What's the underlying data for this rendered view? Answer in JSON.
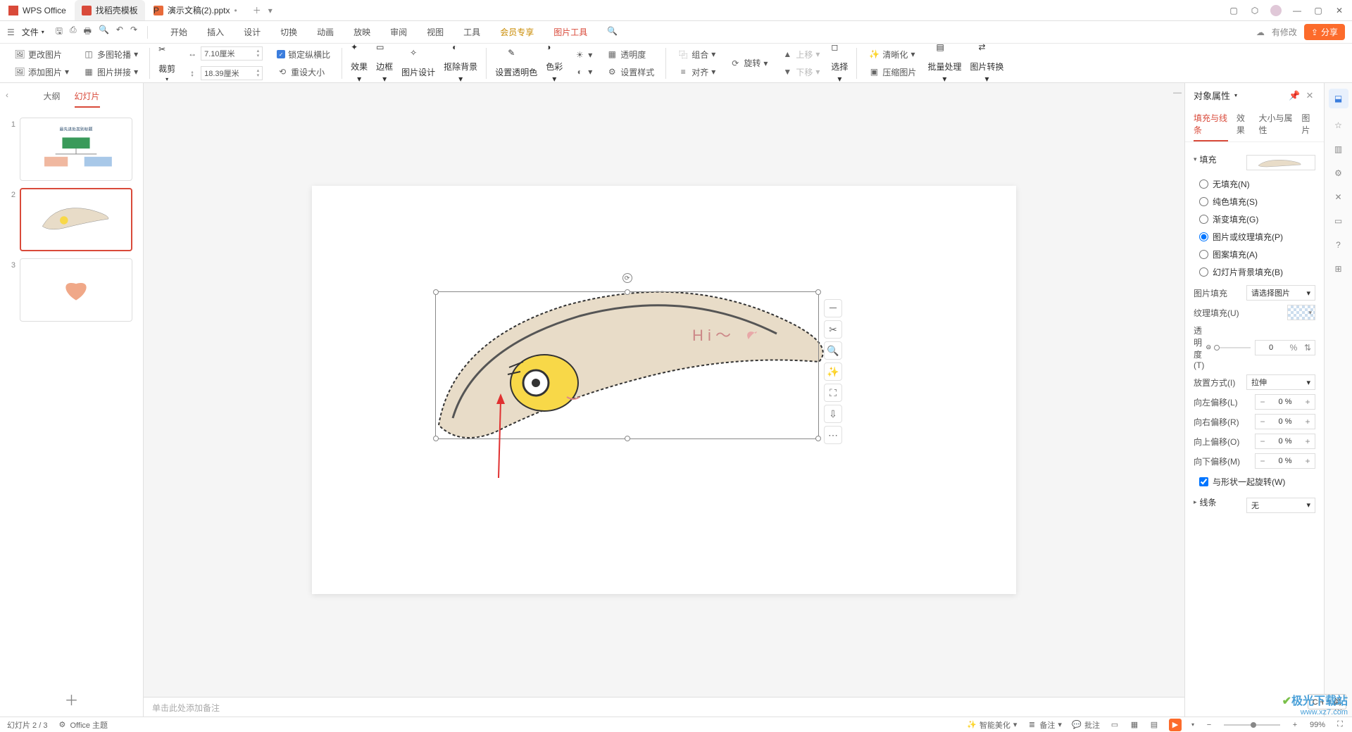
{
  "title_bar": {
    "app_name": "WPS Office",
    "tab_template": "找稻壳模板",
    "tab_doc": "演示文稿(2).pptx"
  },
  "menu": {
    "file": "文件",
    "tabs": [
      "开始",
      "插入",
      "设计",
      "切换",
      "动画",
      "放映",
      "审阅",
      "视图",
      "工具",
      "会员专享",
      "图片工具"
    ],
    "has_changes": "有修改",
    "share": "分享"
  },
  "ribbon": {
    "change_pic": "更改图片",
    "multi_rotate": "多图轮播",
    "add_pic": "添加图片",
    "pic_merge": "图片拼接",
    "crop": "裁剪",
    "width": "7.10厘米",
    "height": "18.39厘米",
    "lock_ratio": "锁定纵横比",
    "reset_size": "重设大小",
    "effect": "效果",
    "border": "边框",
    "pic_design": "图片设计",
    "remove_bg": "抠除背景",
    "set_trans": "设置透明色",
    "color": "色彩",
    "transparency": "透明度",
    "set_style": "设置样式",
    "combine": "组合",
    "rotate": "旋转",
    "align": "对齐",
    "move_up": "上移",
    "move_down": "下移",
    "select": "选择",
    "clarity": "清晰化",
    "compress": "压缩图片",
    "batch": "批量处理",
    "convert": "图片转换"
  },
  "left": {
    "tab_outline": "大纲",
    "tab_slides": "幻灯片",
    "slide_nums": [
      "1",
      "2",
      "3"
    ]
  },
  "canvas": {
    "notes_placeholder": "单击此处添加备注"
  },
  "right": {
    "panel_title": "对象属性",
    "tabs": [
      "填充与线条",
      "效果",
      "大小与属性",
      "图片"
    ],
    "fill_title": "填充",
    "fill_none": "无填充(N)",
    "fill_solid": "纯色填充(S)",
    "fill_gradient": "渐变填充(G)",
    "fill_picture": "图片或纹理填充(P)",
    "fill_pattern": "图案填充(A)",
    "fill_slide_bg": "幻灯片背景填充(B)",
    "pic_fill": "图片填充",
    "pic_fill_sel": "请选择图片",
    "tex_fill": "纹理填充(U)",
    "transparency": "透明度(T)",
    "trans_val": "0",
    "trans_unit": "%",
    "placement": "放置方式(I)",
    "placement_val": "拉伸",
    "off_left": "向左偏移(L)",
    "off_right": "向右偏移(R)",
    "off_top": "向上偏移(O)",
    "off_bottom": "向下偏移(M)",
    "off_val": "0 %",
    "rotate_with": "与形状一起旋转(W)",
    "line_title": "线条",
    "line_val": "无"
  },
  "status": {
    "slide_pos": "幻灯片 2 / 3",
    "theme": "Office 主题",
    "beautify": "智能美化",
    "notes": "备注",
    "comments": "批注",
    "zoom": "99%"
  },
  "ime": "CH ♫ 简",
  "watermark": {
    "name": "极光下载站",
    "url": "www.xz7.com"
  }
}
